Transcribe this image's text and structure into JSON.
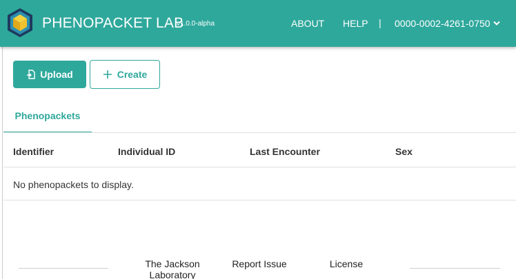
{
  "header": {
    "brand": "PHENOPACKET LAB",
    "version": "v1.0.0-alpha",
    "nav": {
      "about": "ABOUT",
      "help": "HELP",
      "separator": "|",
      "user": "0000-0002-4261-0750"
    },
    "accent_color": "#2fa89c"
  },
  "actions": {
    "upload_label": "Upload",
    "create_label": "Create"
  },
  "tabs": [
    {
      "label": "Phenopackets",
      "active": true
    }
  ],
  "table": {
    "columns": [
      "Identifier",
      "Individual ID",
      "Last Encounter",
      "Sex"
    ],
    "empty_message": "No phenopackets to display."
  },
  "footer": {
    "links": [
      "The Jackson Laboratory",
      "Report Issue",
      "License"
    ]
  }
}
